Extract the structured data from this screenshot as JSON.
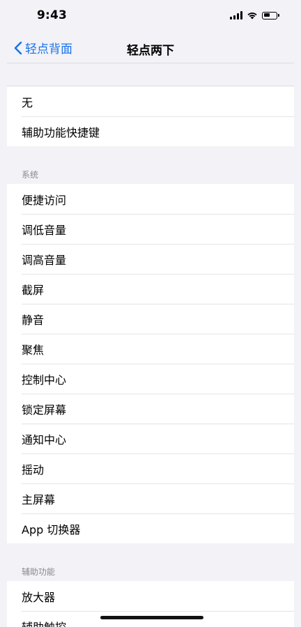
{
  "status_bar": {
    "time": "9:43"
  },
  "nav": {
    "back_label": "轻点背面",
    "title": "轻点两下"
  },
  "accent_color": "#1a73e8",
  "groups": {
    "top": [
      "无",
      "辅助功能快捷键"
    ],
    "system_header": "系统",
    "system": [
      "便捷访问",
      "调低音量",
      "调高音量",
      "截屏",
      "静音",
      "聚焦",
      "控制中心",
      "锁定屏幕",
      "通知中心",
      "摇动",
      "主屏幕",
      "App 切换器"
    ],
    "accessibility_header": "辅助功能",
    "accessibility": [
      "放大器",
      "辅助触控"
    ]
  }
}
